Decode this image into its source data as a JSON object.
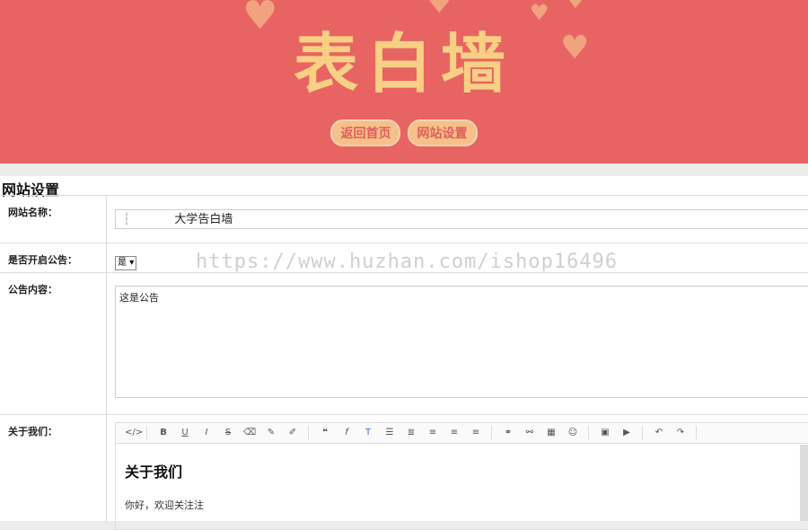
{
  "banner": {
    "title": "表白墙",
    "nav": [
      "返回首页",
      "网站设置"
    ]
  },
  "settings": {
    "section_title": "网站设置",
    "site_name": {
      "label": "网站名称：",
      "value": "大学告白墙"
    },
    "notice_enabled": {
      "label": "是否开启公告：",
      "value": "是"
    },
    "notice_content": {
      "label": "公告内容：",
      "value": "这是公告"
    },
    "about": {
      "label": "关于我们：",
      "heading": "关于我们",
      "paragraph": "你好，欢迎关注注"
    }
  },
  "watermark": "https://www.huzhan.com/ishop16496",
  "colors": {
    "banner_bg": "#e86462",
    "title_color": "#f8d084",
    "button_bg": "#f6c08a",
    "button_text": "#df5f5a"
  },
  "toolbar_icons": [
    "code-icon",
    "bold-icon",
    "underline-icon",
    "italic-icon",
    "strikethrough-icon",
    "eraser-icon",
    "pencil-icon",
    "brush-icon",
    "quote-icon",
    "font-icon",
    "text-color-icon",
    "bullet-list-icon",
    "numbered-list-icon",
    "align-left-icon",
    "align-center-icon",
    "align-right-icon",
    "link-icon",
    "unlink-icon",
    "table-icon",
    "emoji-icon",
    "image-icon",
    "video-icon",
    "undo-icon",
    "redo-icon"
  ]
}
